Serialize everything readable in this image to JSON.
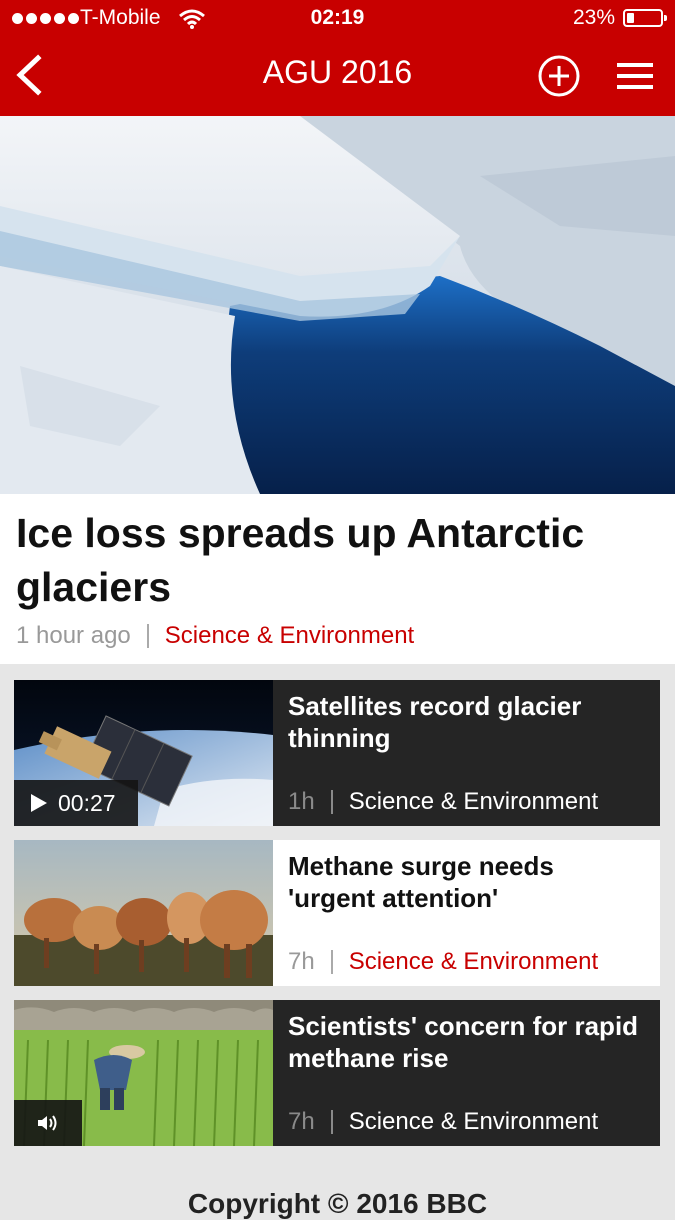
{
  "status_bar": {
    "carrier": "T-Mobile",
    "time": "02:19",
    "battery_percent_label": "23%",
    "battery_level": 0.23
  },
  "nav": {
    "title": "AGU 2016",
    "back_icon": "chevron-left-icon",
    "add_icon": "plus-circle-icon",
    "menu_icon": "hamburger-menu-icon"
  },
  "hero": {
    "image": "antarctic-ice-shelf-photo",
    "headline": "Ice loss spreads up Antarctic glaciers",
    "time": "1 hour ago",
    "category": "Science & Environment"
  },
  "stories": [
    {
      "headline": "Satellites record glacier thinning",
      "time": "1h",
      "category": "Science & Environment",
      "media": "video",
      "duration": "00:27",
      "image": "satellite-over-earth-photo"
    },
    {
      "headline": "Methane surge needs 'urgent attention'",
      "time": "7h",
      "category": "Science & Environment",
      "media": "none",
      "image": "cattle-herd-photo"
    },
    {
      "headline": "Scientists' concern for rapid methane rise",
      "time": "7h",
      "category": "Science & Environment",
      "media": "audio",
      "image": "rice-paddy-farmer-photo"
    }
  ],
  "footer": {
    "copyright": "Copyright © 2016 BBC"
  },
  "colors": {
    "brand_red": "#c80000",
    "dark_card": "#252525",
    "background": "#e6e6e6"
  }
}
